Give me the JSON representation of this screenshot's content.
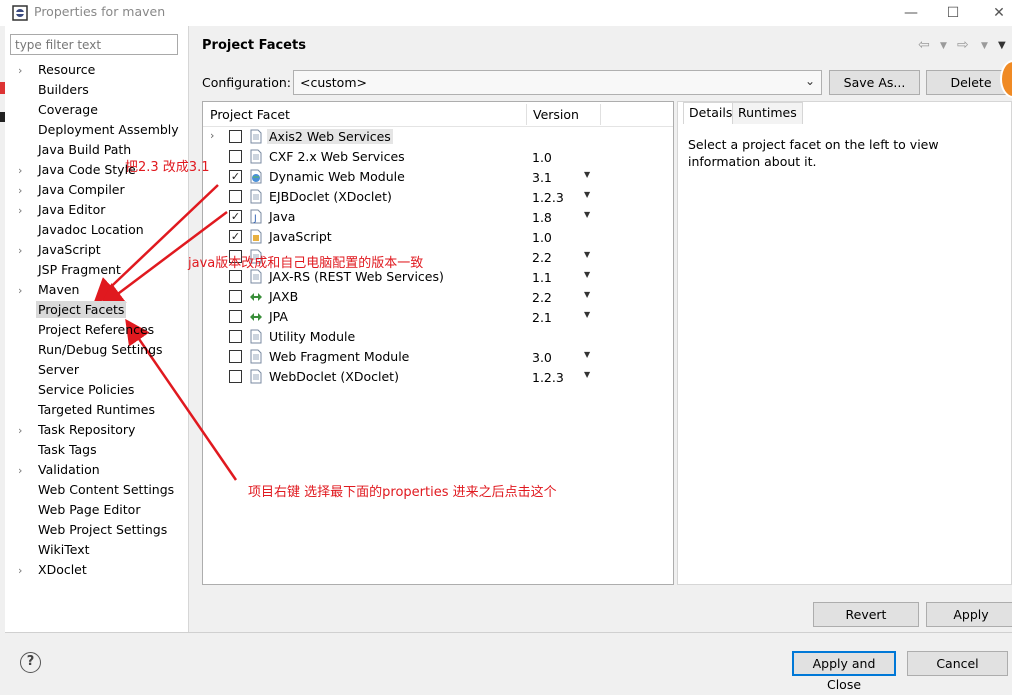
{
  "window": {
    "title": "Properties for maven",
    "controls": {
      "minimize": "—",
      "maximize": "☐",
      "close": "✕"
    }
  },
  "sidebar": {
    "filter_placeholder": "type filter text",
    "items": [
      {
        "label": "Resource",
        "expandable": true
      },
      {
        "label": "Builders",
        "expandable": false
      },
      {
        "label": "Coverage",
        "expandable": false
      },
      {
        "label": "Deployment Assembly",
        "expandable": false
      },
      {
        "label": "Java Build Path",
        "expandable": false
      },
      {
        "label": "Java Code Style",
        "expandable": true
      },
      {
        "label": "Java Compiler",
        "expandable": true
      },
      {
        "label": "Java Editor",
        "expandable": true
      },
      {
        "label": "Javadoc Location",
        "expandable": false
      },
      {
        "label": "JavaScript",
        "expandable": true
      },
      {
        "label": "JSP Fragment",
        "expandable": false
      },
      {
        "label": "Maven",
        "expandable": true
      },
      {
        "label": "Project Facets",
        "expandable": false,
        "selected": true
      },
      {
        "label": "Project References",
        "expandable": false
      },
      {
        "label": "Run/Debug Settings",
        "expandable": false
      },
      {
        "label": "Server",
        "expandable": false
      },
      {
        "label": "Service Policies",
        "expandable": false
      },
      {
        "label": "Targeted Runtimes",
        "expandable": false
      },
      {
        "label": "Task Repository",
        "expandable": true
      },
      {
        "label": "Task Tags",
        "expandable": false
      },
      {
        "label": "Validation",
        "expandable": true
      },
      {
        "label": "Web Content Settings",
        "expandable": false
      },
      {
        "label": "Web Page Editor",
        "expandable": false
      },
      {
        "label": "Web Project Settings",
        "expandable": false
      },
      {
        "label": "WikiText",
        "expandable": false
      },
      {
        "label": "XDoclet",
        "expandable": true
      }
    ]
  },
  "main": {
    "title": "Project Facets",
    "configuration_label": "Configuration:",
    "configuration_value": "<custom>",
    "save_as_label": "Save As...",
    "delete_label": "Delete",
    "table": {
      "col_facet": "Project Facet",
      "col_version": "Version",
      "rows": [
        {
          "name": "Axis2 Web Services",
          "checked": false,
          "version": "",
          "dropdown": false,
          "expandable": true,
          "highlight": true,
          "icon": "doc"
        },
        {
          "name": "CXF 2.x Web Services",
          "checked": false,
          "version": "1.0",
          "dropdown": false,
          "icon": "doc"
        },
        {
          "name": "Dynamic Web Module",
          "checked": true,
          "version": "3.1",
          "dropdown": true,
          "icon": "globe"
        },
        {
          "name": "EJBDoclet (XDoclet)",
          "checked": false,
          "version": "1.2.3",
          "dropdown": true,
          "icon": "doc"
        },
        {
          "name": "Java",
          "checked": true,
          "version": "1.8",
          "dropdown": true,
          "icon": "java"
        },
        {
          "name": "JavaScript",
          "checked": true,
          "version": "1.0",
          "dropdown": false,
          "icon": "js"
        },
        {
          "name": "",
          "checked": false,
          "version": "2.2",
          "dropdown": true,
          "icon": "doc"
        },
        {
          "name": "JAX-RS (REST Web Services)",
          "checked": false,
          "version": "1.1",
          "dropdown": true,
          "icon": "doc"
        },
        {
          "name": "JAXB",
          "checked": false,
          "version": "2.2",
          "dropdown": true,
          "icon": "xml"
        },
        {
          "name": "JPA",
          "checked": false,
          "version": "2.1",
          "dropdown": true,
          "icon": "xml"
        },
        {
          "name": "Utility Module",
          "checked": false,
          "version": "",
          "dropdown": false,
          "icon": "doc"
        },
        {
          "name": "Web Fragment Module",
          "checked": false,
          "version": "3.0",
          "dropdown": true,
          "icon": "doc"
        },
        {
          "name": "WebDoclet (XDoclet)",
          "checked": false,
          "version": "1.2.3",
          "dropdown": true,
          "icon": "doc"
        }
      ]
    },
    "details": {
      "tab_details": "Details",
      "tab_runtimes": "Runtimes",
      "text": "Select a project facet on the left to view information about it."
    },
    "revert_label": "Revert",
    "apply_label": "Apply"
  },
  "footer": {
    "help": "?",
    "apply_close_label": "Apply and Close",
    "cancel_label": "Cancel"
  },
  "annotations": {
    "note1": "把2.3 改成3.1",
    "note2": "java版本改成和自己电脑配置的版本一致",
    "note3": "项目右键 选择最下面的properties 进来之后点击这个"
  },
  "colors": {
    "annotation": "#e0191f",
    "accent": "#0078d7",
    "selection": "#d9d9d9"
  }
}
